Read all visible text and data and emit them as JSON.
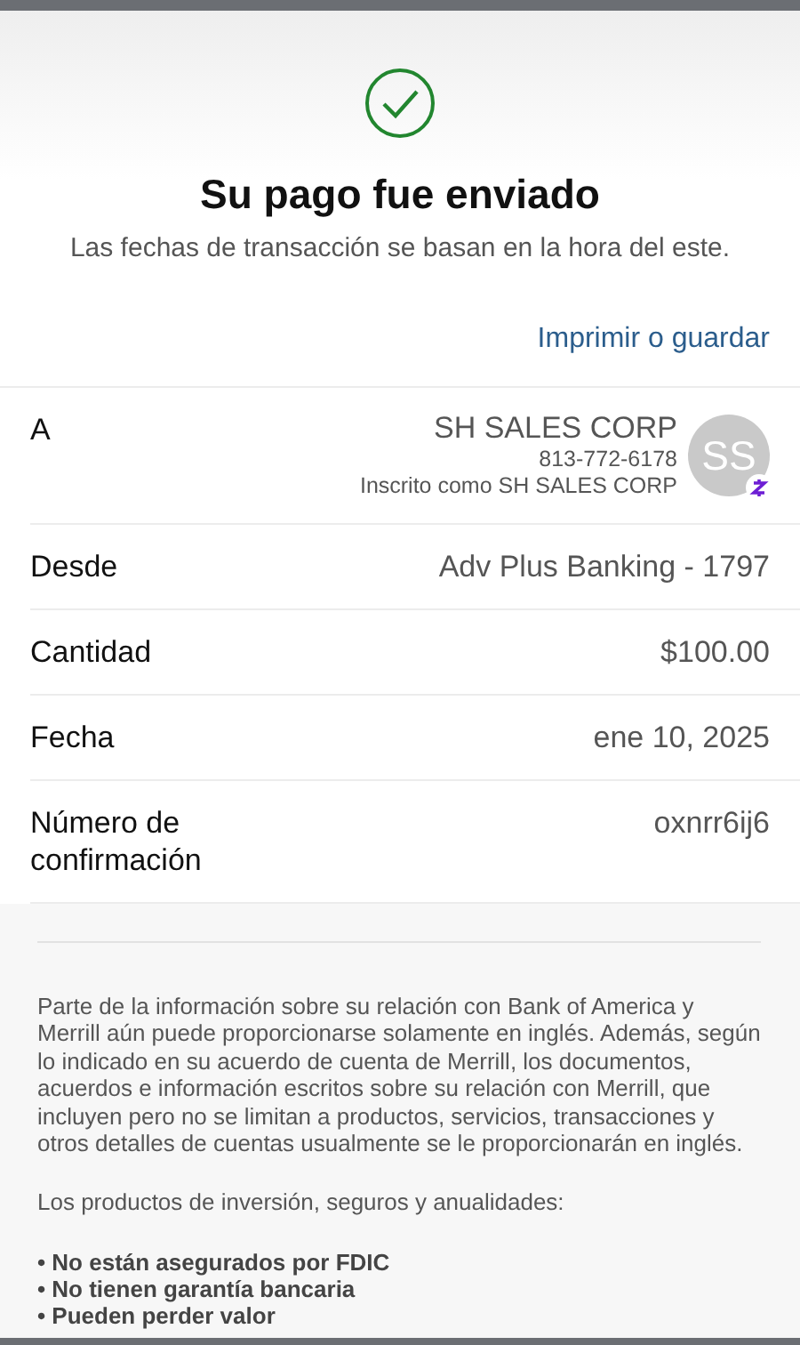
{
  "header": {
    "title": "Su pago fue enviado",
    "subtitle": "Las fechas de transacción se basan en la hora del este.",
    "print_link": "Imprimir o guardar"
  },
  "details": [
    {
      "kind": "payee",
      "label": "A",
      "name": "SH SALES CORP",
      "phone": "813-772-6178",
      "enrolled": "Inscrito como SH SALES CORP",
      "initials": "SS"
    },
    {
      "kind": "simple",
      "label": "Desde",
      "value": "Adv Plus Banking - 1797"
    },
    {
      "kind": "simple",
      "label": "Cantidad",
      "value": "$100.00"
    },
    {
      "kind": "simple",
      "label": "Fecha",
      "value": "ene 10, 2025"
    },
    {
      "kind": "simple",
      "label": "Número de confirmación",
      "value": "oxnrr6ij6"
    }
  ],
  "disclosure": {
    "paragraphs": [
      "Parte de la información sobre su relación con Bank of America y Merrill aún puede proporcionarse solamente en inglés. Además, según lo indicado en su acuerdo de cuenta de Merrill, los documentos, acuerdos e información escritos sobre su relación con Merrill, que incluyen pero no se limitan a productos, servicios, transacciones y otros detalles de cuentas usualmente se le proporcionarán en inglés.",
      "Los productos de inversión, seguros y anualidades:"
    ],
    "bullets": [
      "• No están asegurados por FDIC",
      "• No tienen garantía bancaria",
      "• Pueden perder valor"
    ]
  }
}
